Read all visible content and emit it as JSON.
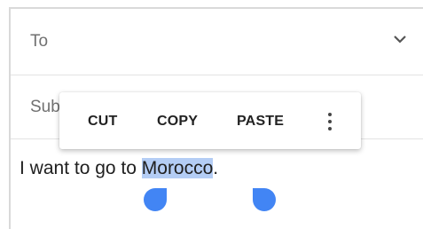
{
  "compose": {
    "to_label": "To",
    "subject_label": "Subject",
    "subject_visible": "Sub",
    "body_before": "I want to go to ",
    "body_selected": "Morocco",
    "body_after": "."
  },
  "context_menu": {
    "cut": "CUT",
    "copy": "COPY",
    "paste": "PASTE",
    "more_icon": "more-vert-icon"
  },
  "colors": {
    "selection": "#b4cdf5",
    "handle": "#4285f4"
  }
}
